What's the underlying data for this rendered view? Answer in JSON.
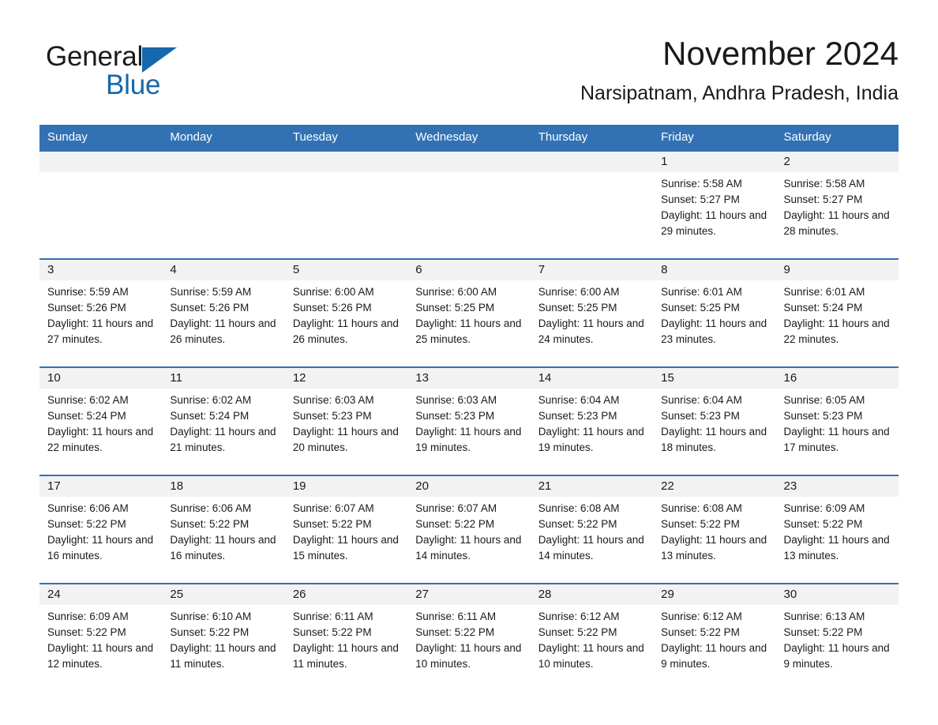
{
  "brand": {
    "name_part1": "General",
    "name_part2": "Blue",
    "logo_icon": "triangle-logo-icon",
    "accent_color": "#1668ac"
  },
  "header": {
    "month_title": "November 2024",
    "location": "Narsipatnam, Andhra Pradesh, India"
  },
  "calendar": {
    "header_color": "#3272b4",
    "daynum_band_color": "#f2f2f2",
    "weekdays": [
      "Sunday",
      "Monday",
      "Tuesday",
      "Wednesday",
      "Thursday",
      "Friday",
      "Saturday"
    ],
    "weeks": [
      [
        {
          "day": "",
          "empty": true
        },
        {
          "day": "",
          "empty": true
        },
        {
          "day": "",
          "empty": true
        },
        {
          "day": "",
          "empty": true
        },
        {
          "day": "",
          "empty": true
        },
        {
          "day": "1",
          "sunrise": "Sunrise: 5:58 AM",
          "sunset": "Sunset: 5:27 PM",
          "daylight": "Daylight: 11 hours and 29 minutes."
        },
        {
          "day": "2",
          "sunrise": "Sunrise: 5:58 AM",
          "sunset": "Sunset: 5:27 PM",
          "daylight": "Daylight: 11 hours and 28 minutes."
        }
      ],
      [
        {
          "day": "3",
          "sunrise": "Sunrise: 5:59 AM",
          "sunset": "Sunset: 5:26 PM",
          "daylight": "Daylight: 11 hours and 27 minutes."
        },
        {
          "day": "4",
          "sunrise": "Sunrise: 5:59 AM",
          "sunset": "Sunset: 5:26 PM",
          "daylight": "Daylight: 11 hours and 26 minutes."
        },
        {
          "day": "5",
          "sunrise": "Sunrise: 6:00 AM",
          "sunset": "Sunset: 5:26 PM",
          "daylight": "Daylight: 11 hours and 26 minutes."
        },
        {
          "day": "6",
          "sunrise": "Sunrise: 6:00 AM",
          "sunset": "Sunset: 5:25 PM",
          "daylight": "Daylight: 11 hours and 25 minutes."
        },
        {
          "day": "7",
          "sunrise": "Sunrise: 6:00 AM",
          "sunset": "Sunset: 5:25 PM",
          "daylight": "Daylight: 11 hours and 24 minutes."
        },
        {
          "day": "8",
          "sunrise": "Sunrise: 6:01 AM",
          "sunset": "Sunset: 5:25 PM",
          "daylight": "Daylight: 11 hours and 23 minutes."
        },
        {
          "day": "9",
          "sunrise": "Sunrise: 6:01 AM",
          "sunset": "Sunset: 5:24 PM",
          "daylight": "Daylight: 11 hours and 22 minutes."
        }
      ],
      [
        {
          "day": "10",
          "sunrise": "Sunrise: 6:02 AM",
          "sunset": "Sunset: 5:24 PM",
          "daylight": "Daylight: 11 hours and 22 minutes."
        },
        {
          "day": "11",
          "sunrise": "Sunrise: 6:02 AM",
          "sunset": "Sunset: 5:24 PM",
          "daylight": "Daylight: 11 hours and 21 minutes."
        },
        {
          "day": "12",
          "sunrise": "Sunrise: 6:03 AM",
          "sunset": "Sunset: 5:23 PM",
          "daylight": "Daylight: 11 hours and 20 minutes."
        },
        {
          "day": "13",
          "sunrise": "Sunrise: 6:03 AM",
          "sunset": "Sunset: 5:23 PM",
          "daylight": "Daylight: 11 hours and 19 minutes."
        },
        {
          "day": "14",
          "sunrise": "Sunrise: 6:04 AM",
          "sunset": "Sunset: 5:23 PM",
          "daylight": "Daylight: 11 hours and 19 minutes."
        },
        {
          "day": "15",
          "sunrise": "Sunrise: 6:04 AM",
          "sunset": "Sunset: 5:23 PM",
          "daylight": "Daylight: 11 hours and 18 minutes."
        },
        {
          "day": "16",
          "sunrise": "Sunrise: 6:05 AM",
          "sunset": "Sunset: 5:23 PM",
          "daylight": "Daylight: 11 hours and 17 minutes."
        }
      ],
      [
        {
          "day": "17",
          "sunrise": "Sunrise: 6:06 AM",
          "sunset": "Sunset: 5:22 PM",
          "daylight": "Daylight: 11 hours and 16 minutes."
        },
        {
          "day": "18",
          "sunrise": "Sunrise: 6:06 AM",
          "sunset": "Sunset: 5:22 PM",
          "daylight": "Daylight: 11 hours and 16 minutes."
        },
        {
          "day": "19",
          "sunrise": "Sunrise: 6:07 AM",
          "sunset": "Sunset: 5:22 PM",
          "daylight": "Daylight: 11 hours and 15 minutes."
        },
        {
          "day": "20",
          "sunrise": "Sunrise: 6:07 AM",
          "sunset": "Sunset: 5:22 PM",
          "daylight": "Daylight: 11 hours and 14 minutes."
        },
        {
          "day": "21",
          "sunrise": "Sunrise: 6:08 AM",
          "sunset": "Sunset: 5:22 PM",
          "daylight": "Daylight: 11 hours and 14 minutes."
        },
        {
          "day": "22",
          "sunrise": "Sunrise: 6:08 AM",
          "sunset": "Sunset: 5:22 PM",
          "daylight": "Daylight: 11 hours and 13 minutes."
        },
        {
          "day": "23",
          "sunrise": "Sunrise: 6:09 AM",
          "sunset": "Sunset: 5:22 PM",
          "daylight": "Daylight: 11 hours and 13 minutes."
        }
      ],
      [
        {
          "day": "24",
          "sunrise": "Sunrise: 6:09 AM",
          "sunset": "Sunset: 5:22 PM",
          "daylight": "Daylight: 11 hours and 12 minutes."
        },
        {
          "day": "25",
          "sunrise": "Sunrise: 6:10 AM",
          "sunset": "Sunset: 5:22 PM",
          "daylight": "Daylight: 11 hours and 11 minutes."
        },
        {
          "day": "26",
          "sunrise": "Sunrise: 6:11 AM",
          "sunset": "Sunset: 5:22 PM",
          "daylight": "Daylight: 11 hours and 11 minutes."
        },
        {
          "day": "27",
          "sunrise": "Sunrise: 6:11 AM",
          "sunset": "Sunset: 5:22 PM",
          "daylight": "Daylight: 11 hours and 10 minutes."
        },
        {
          "day": "28",
          "sunrise": "Sunrise: 6:12 AM",
          "sunset": "Sunset: 5:22 PM",
          "daylight": "Daylight: 11 hours and 10 minutes."
        },
        {
          "day": "29",
          "sunrise": "Sunrise: 6:12 AM",
          "sunset": "Sunset: 5:22 PM",
          "daylight": "Daylight: 11 hours and 9 minutes."
        },
        {
          "day": "30",
          "sunrise": "Sunrise: 6:13 AM",
          "sunset": "Sunset: 5:22 PM",
          "daylight": "Daylight: 11 hours and 9 minutes."
        }
      ]
    ]
  }
}
